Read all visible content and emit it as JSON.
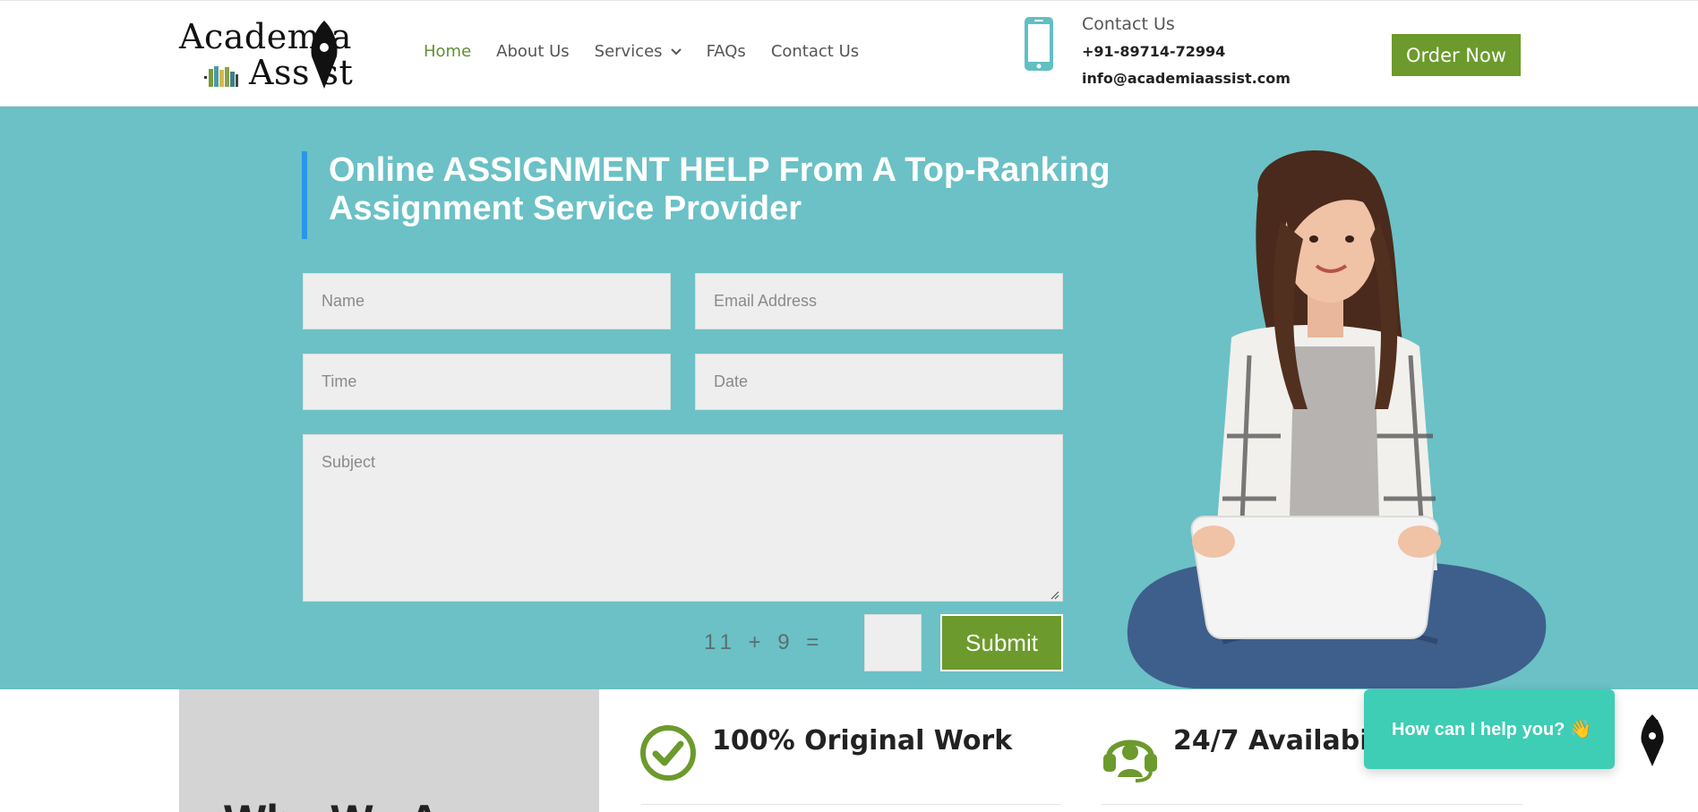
{
  "brand": {
    "logo_line1": "Academ a",
    "logo_line2": "Ass st"
  },
  "nav": {
    "items": [
      {
        "label": "Home",
        "active": true
      },
      {
        "label": "About Us"
      },
      {
        "label": "Services",
        "has_dropdown": true
      },
      {
        "label": "FAQs"
      },
      {
        "label": "Contact Us"
      }
    ]
  },
  "contact": {
    "title": "Contact Us",
    "phone": "+91-89714-72994",
    "email": "info@academiaassist.com",
    "icon": "smartphone-icon"
  },
  "header": {
    "order_label": "Order Now"
  },
  "hero": {
    "title_line1": "Online ASSIGNMENT HELP From A Top-Ranking",
    "title_line2": "Assignment Service Provider",
    "form": {
      "name_placeholder": "Name",
      "email_placeholder": "Email Address",
      "time_placeholder": "Time",
      "date_placeholder": "Date",
      "subject_placeholder": "Subject",
      "captcha": "11 + 9 =",
      "submit_label": "Submit"
    }
  },
  "features": [
    {
      "title": "100% Original Work",
      "icon": "check-circle-icon"
    },
    {
      "title": "24/7 Availabil",
      "icon": "headset-icon"
    }
  ],
  "lower": {
    "heading_partial": "Why We A"
  },
  "chat": {
    "prompt": "How can I help you? 👋"
  },
  "colors": {
    "accent_green": "#6c9a2c",
    "hero_bg": "#6bc1c6",
    "title_bar": "#2a96e8",
    "chat_bg": "#3ecdb5"
  }
}
